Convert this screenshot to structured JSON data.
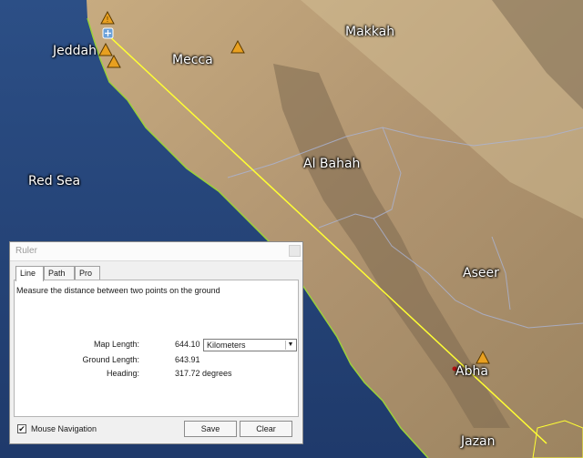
{
  "map": {
    "places": {
      "jeddah": "Jeddah",
      "mecca": "Mecca",
      "makkah": "Makkah",
      "red_sea": "Red Sea",
      "al_bahah": "Al Bahah",
      "aseer": "Aseer",
      "abha": "Abha",
      "jazan": "Jazan"
    },
    "colors": {
      "sea": "#2b4c80",
      "land": "#b89c72",
      "measure_line": "#ffff33",
      "marker": "#e8a020"
    }
  },
  "ruler": {
    "title": "Ruler",
    "tabs": [
      "Line",
      "Path",
      "Pro"
    ],
    "active_tab": "Line",
    "description": "Measure the distance between two points on the ground",
    "map_length_label": "Map Length:",
    "map_length_value": "644.10",
    "unit_selected": "Kilometers",
    "ground_length_label": "Ground Length:",
    "ground_length_value": "643.91",
    "heading_label": "Heading:",
    "heading_value": "317.72 degrees",
    "mouse_nav_label": "Mouse Navigation",
    "mouse_nav_checked": true,
    "save_label": "Save",
    "clear_label": "Clear"
  }
}
